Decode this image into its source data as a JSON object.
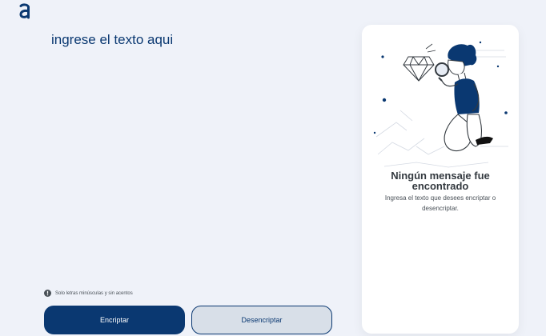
{
  "logo": {
    "icon": "alura-a-logo-icon",
    "color": "#0a3871"
  },
  "editor": {
    "placeholder": "ingrese el texto aqui",
    "value": ""
  },
  "hint": {
    "icon": "info-icon",
    "text": "Solo letras minúsculas y sin acentos"
  },
  "buttons": {
    "encrypt_label": "Encriptar",
    "decrypt_label": "Desencriptar"
  },
  "output_panel": {
    "illustration": "person-with-magnifying-glass-illustration",
    "title_line1": "Ningún mensaje fue",
    "title_line2": "encontrado",
    "description": "Ingresa el texto que desees encriptar o desencriptar."
  },
  "colors": {
    "background": "#eff2f9",
    "primary": "#0a3871",
    "secondary_button": "#d8dfe8",
    "panel": "#ffffff"
  }
}
